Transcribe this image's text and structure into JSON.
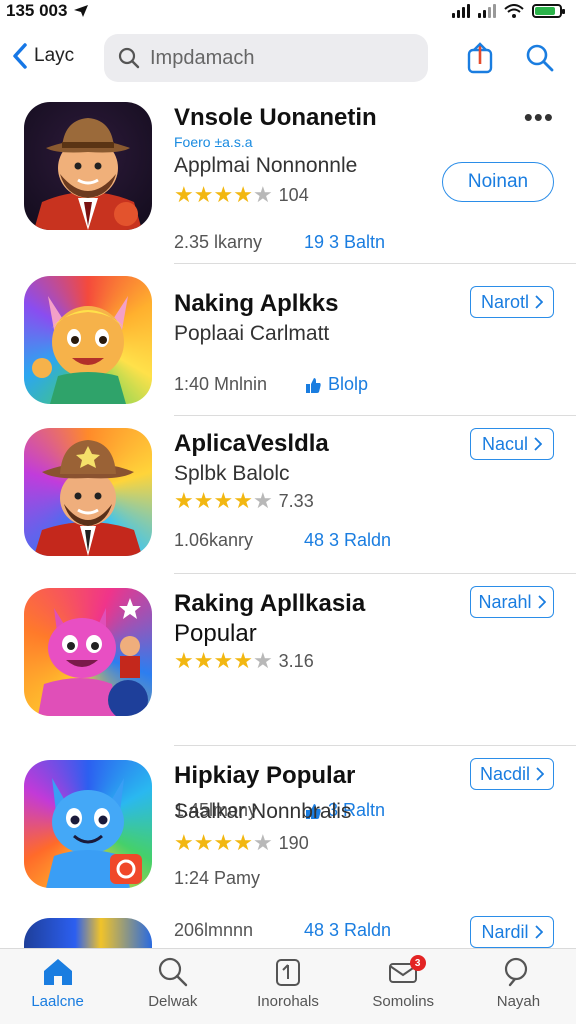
{
  "status": {
    "time": "135 003"
  },
  "nav": {
    "back_label": "Layc",
    "search_placeholder": "Impdamach"
  },
  "apps": [
    {
      "title": "Vnsole Uonanetin",
      "tagline": "Foero ±a.s.a",
      "subtitle": "Applmai Nonnonnle",
      "rating": 3.5,
      "rating_count": "104",
      "meta": "2.35 lkarny",
      "badge": "19 3 Baltn",
      "badge_icon": "",
      "button": "Noinan"
    },
    {
      "title": "Naking Aplkks",
      "subtitle": "Poplaai Carlmatt",
      "meta": "1:40 Mnlnin",
      "badge": "Blolp",
      "badge_icon": "thumb-icon",
      "button": "Narotl"
    },
    {
      "title": "AplicaVesldla",
      "subtitle": "Splbk Balolc",
      "rating": 3.5,
      "rating_count": "7.33",
      "meta": "1.06kanry",
      "badge": "48 3 Raldn",
      "badge_icon": "",
      "button": "Nacul"
    },
    {
      "title": "Raking Apllkasia",
      "title2": "Popular",
      "rating": 3.5,
      "rating_count": "3.16",
      "meta": "1.45lmony",
      "badge": "3 Raltn",
      "badge_icon": "thumb-icon",
      "button": "Narahl"
    },
    {
      "title": "Hipkiay Popular",
      "subtitle": "Saalkar Nonnbralis",
      "rating": 4,
      "rating_count": "190",
      "meta": "1:24 Pamy",
      "button": "Nacdil"
    },
    {
      "meta": "206lmnnn",
      "badge": "48 3 Raldn",
      "button": "Nardil"
    }
  ],
  "tabs": [
    {
      "label": "Laalcne",
      "icon": "home-icon",
      "active": true
    },
    {
      "label": "Delwak",
      "icon": "search-icon",
      "active": false
    },
    {
      "label": "Inorohals",
      "icon": "apps-icon",
      "active": false
    },
    {
      "label": "Somolins",
      "icon": "inbox-icon",
      "active": false,
      "badge": "3"
    },
    {
      "label": "Nayah",
      "icon": "search-icon",
      "active": false
    }
  ],
  "colors": {
    "accent": "#1a7de0",
    "star": "#f2b711",
    "notification": "#e32424"
  }
}
